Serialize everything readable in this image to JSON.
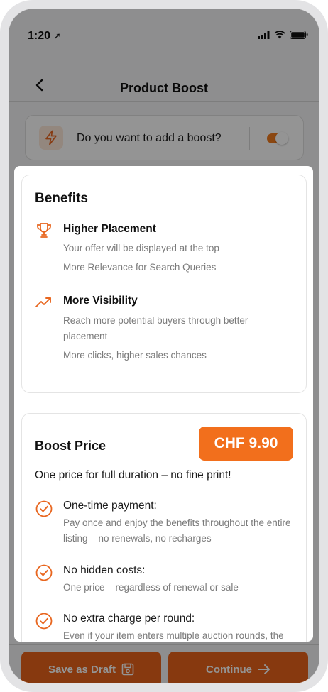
{
  "status_bar": {
    "time": "1:20"
  },
  "header": {
    "title": "Product Boost"
  },
  "boost_toggle": {
    "question": "Do you want to add a boost?",
    "enabled": true
  },
  "benefits": {
    "title": "Benefits",
    "items": [
      {
        "icon": "trophy-icon",
        "title": "Higher Placement",
        "lines": [
          "Your offer will be displayed at the top",
          "More Relevance for Search Queries"
        ]
      },
      {
        "icon": "trending-up-icon",
        "title": "More Visibility",
        "lines": [
          "Reach more potential buyers through better placement",
          "More clicks, higher sales chances"
        ]
      }
    ]
  },
  "boost_price": {
    "title": "Boost Price",
    "price": "CHF 9.90",
    "subtitle": "One price for full duration – no fine print!",
    "items": [
      {
        "title": "One-time payment:",
        "desc": "Pay once and enjoy the benefits throughout the entire listing – no renewals, no recharges"
      },
      {
        "title": "No hidden costs:",
        "desc": "One price – regardless of renewal or sale"
      },
      {
        "title": "No extra charge per round:",
        "desc": "Even if your item enters multiple auction rounds, the"
      }
    ]
  },
  "footer": {
    "save_draft_label": "Save as Draft",
    "continue_label": "Continue"
  },
  "colors": {
    "accent": "#f26f1c",
    "button": "#e9631a",
    "muted_text": "#7a7a7a"
  }
}
